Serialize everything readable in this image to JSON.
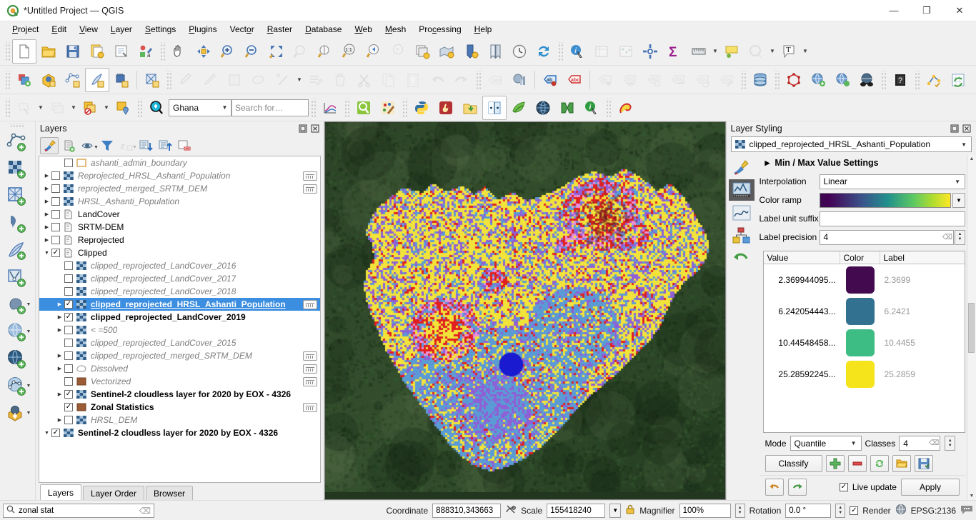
{
  "window": {
    "title": "*Untitled Project — QGIS",
    "app_icon": "qgis-logo-icon",
    "minimize": "—",
    "maximize": "❐",
    "close": "✕"
  },
  "menubar": {
    "items": [
      {
        "label": "Project",
        "accel": "P"
      },
      {
        "label": "Edit",
        "accel": "E"
      },
      {
        "label": "View",
        "accel": "V"
      },
      {
        "label": "Layer",
        "accel": "L"
      },
      {
        "label": "Settings",
        "accel": "S"
      },
      {
        "label": "Plugins",
        "accel": "P"
      },
      {
        "label": "Vector",
        "accel": "o"
      },
      {
        "label": "Raster",
        "accel": "R"
      },
      {
        "label": "Database",
        "accel": "D"
      },
      {
        "label": "Web",
        "accel": "W"
      },
      {
        "label": "Mesh",
        "accel": "M"
      },
      {
        "label": "Processing",
        "accel": "c"
      },
      {
        "label": "Help",
        "accel": "H"
      }
    ]
  },
  "toolbar": {
    "row1": [
      "new-project-icon",
      "open-project-icon",
      "save-project-icon",
      "save-project-as-icon",
      "new-print-layout-icon",
      "style-manager-icon",
      "sep",
      "pan-map-icon",
      "pan-to-selection-icon",
      "zoom-in-icon",
      "zoom-out-icon",
      "zoom-full-icon",
      "zoom-to-selection-icon",
      "zoom-to-layer-icon",
      "zoom-native-icon",
      "zoom-last-icon",
      "zoom-next-icon",
      "refresh-layer-icon",
      "new-map-view-icon",
      "new-3d-map-view-icon",
      "bookmarks-icon",
      "temporal-controller-icon",
      "refresh-icon",
      "sep",
      "identify-features-icon",
      "open-attribute-table-icon",
      "statistical-summary-icon",
      "options-icon",
      "sum-icon",
      "measure-line-icon",
      "map-tips-icon",
      "show-pinned-labels-icon",
      "text-annotation-icon"
    ],
    "row2": [
      "new-shapefile-layer-icon",
      "new-geopackage-layer-icon",
      "new-spatialite-layer-icon",
      "new-virtual-layer-icon",
      "new-memory-layer-icon",
      "sep",
      "new-mesh-layer-icon",
      "sep",
      "current-edits-icon",
      "toggle-editing-icon",
      "save-layer-edits-icon",
      "add-polygon-feature-icon",
      "vertex-tool-icon",
      "modify-attributes-icon",
      "delete-selected-icon",
      "cut-features-icon",
      "copy-features-icon",
      "paste-features-icon",
      "undo-icon",
      "redo-icon",
      "sep",
      "label-icon",
      "diagram-icon",
      "sep",
      "pin-labels-icon",
      "highlight-labels-icon",
      "sep",
      "move-label-icon",
      "show-hide-labels-icon",
      "change-label-icon",
      "rotate-label-icon",
      "move-label-part-icon",
      "revert-label-icon",
      "edit-label-icon",
      "sep",
      "database-manager-icon",
      "sep",
      "topology-checker-icon",
      "metasearch-icon",
      "metasearch-zoom-icon",
      "geocoding-icon",
      "sep",
      "help-contents-icon",
      "sep",
      "qgis-cloud-icon",
      "refresh-table-icon"
    ],
    "row3": [
      "select-features-icon",
      "select-dropdown",
      "deselect-icon",
      "deselect-dropdown",
      "select-value-icon",
      "select-value-dropdown",
      "select-by-location-icon",
      "sep",
      "locator-search-icon"
    ],
    "row3_combo_value": "Ghana",
    "row3_search_placeholder": "Search for…",
    "row3_right": [
      "profile-tool-icon",
      "sep",
      "search-layers-icon",
      "plugin-paint-icon",
      "sep",
      "python-console-icon",
      "qgis-resource-sharing-icon",
      "data-plotly-icon",
      "swipe-tool-icon",
      "leaflet-icon",
      "globe-icon",
      "freehand-icon",
      "info-plugin-icon",
      "sep",
      "lasso-icon"
    ]
  },
  "left_toolbar": {
    "items": [
      "add-vector-layer-icon",
      "add-raster-layer-icon",
      "add-mesh-layer-icon",
      "add-delimited-text-layer-icon",
      "add-spatialite-layer-icon",
      "add-virtual-layer-icon",
      "add-postgis-layer-icon",
      "add-mssql-layer-icon",
      "add-wms-layer-icon",
      "add-wfs-layer-icon",
      "add-wcs-layer-icon"
    ]
  },
  "layers_panel": {
    "title": "Layers",
    "dock_buttons": [
      "undock-icon",
      "close-icon"
    ],
    "toolbar": [
      "open-layer-styling-icon",
      "add-group-icon",
      "manage-visibility-icon",
      "filter-legend-icon",
      "filter-legend-expression-icon",
      "expand-all-icon",
      "collapse-all-icon",
      "remove-layer-icon"
    ],
    "tabs": [
      {
        "label": "Layers",
        "active": true
      },
      {
        "label": "Layer Order",
        "active": false
      },
      {
        "label": "Browser",
        "active": false
      }
    ],
    "items": [
      {
        "name": "ashanti_admin_boundary",
        "indent": 1,
        "expander": false,
        "checked": false,
        "icon": "polygon-outline-icon",
        "style": "italic-grey",
        "chip": false
      },
      {
        "name": "Reprojected_HRSL_Ashanti_Population",
        "indent": 0,
        "expander": true,
        "checked": false,
        "icon": "raster-icon",
        "style": "italic-grey",
        "chip": true
      },
      {
        "name": "reprojected_merged_SRTM_DEM",
        "indent": 0,
        "expander": true,
        "checked": false,
        "icon": "raster-icon",
        "style": "italic-grey",
        "chip": true
      },
      {
        "name": "HRSL_Ashanti_Population",
        "indent": 0,
        "expander": true,
        "checked": false,
        "icon": "raster-icon",
        "style": "italic-grey",
        "chip": false
      },
      {
        "name": "LandCover",
        "indent": 0,
        "expander": true,
        "checked": false,
        "icon": "group-icon",
        "style": "normal",
        "chip": false
      },
      {
        "name": "SRTM-DEM",
        "indent": 0,
        "expander": true,
        "checked": false,
        "icon": "group-icon",
        "style": "normal",
        "chip": false
      },
      {
        "name": "Reprojected",
        "indent": 0,
        "expander": true,
        "checked": false,
        "icon": "group-icon",
        "style": "normal",
        "chip": false
      },
      {
        "name": "Clipped",
        "indent": 0,
        "expander": "open",
        "checked": true,
        "icon": "group-icon",
        "style": "normal",
        "chip": false
      },
      {
        "name": "clipped_reprojected_LandCover_2016",
        "indent": 1,
        "expander": false,
        "checked": false,
        "icon": "raster-icon",
        "style": "italic-grey",
        "chip": false
      },
      {
        "name": "clipped_reprojected_LandCover_2017",
        "indent": 1,
        "expander": false,
        "checked": false,
        "icon": "raster-icon",
        "style": "italic-grey",
        "chip": false
      },
      {
        "name": "clipped_reprojected_LandCover_2018",
        "indent": 1,
        "expander": false,
        "checked": false,
        "icon": "raster-icon",
        "style": "italic-grey",
        "chip": false
      },
      {
        "name": "clipped_reprojected_HRSL_Ashanti_Population",
        "indent": 1,
        "expander": true,
        "checked": true,
        "icon": "raster-icon",
        "style": "selected",
        "chip": true,
        "selected": true
      },
      {
        "name": "clipped_reprojected_LandCover_2019",
        "indent": 1,
        "expander": true,
        "checked": true,
        "icon": "raster-icon",
        "style": "bold",
        "chip": false
      },
      {
        "name": "< =500",
        "indent": 1,
        "expander": true,
        "checked": false,
        "icon": "raster-icon",
        "style": "italic-grey",
        "chip": false
      },
      {
        "name": "clipped_reprojected_LandCover_2015",
        "indent": 1,
        "expander": false,
        "checked": false,
        "icon": "raster-icon",
        "style": "italic-grey",
        "chip": false
      },
      {
        "name": "clipped_reprojected_merged_SRTM_DEM",
        "indent": 1,
        "expander": true,
        "checked": false,
        "icon": "raster-icon",
        "style": "italic-grey",
        "chip": true
      },
      {
        "name": "Dissolved",
        "indent": 1,
        "expander": true,
        "checked": false,
        "icon": "polygon-grey-icon",
        "style": "italic-grey",
        "chip": true
      },
      {
        "name": "Vectorized",
        "indent": 1,
        "expander": false,
        "checked": false,
        "icon": "polygon-brown-icon",
        "style": "italic-grey",
        "chip": true
      },
      {
        "name": "Sentinel-2 cloudless layer for 2020 by EOX - 4326",
        "indent": 1,
        "expander": true,
        "checked": true,
        "icon": "raster-icon",
        "style": "bold",
        "chip": false
      },
      {
        "name": "Zonal Statistics",
        "indent": 1,
        "expander": false,
        "checked": true,
        "icon": "polygon-brown-icon",
        "style": "bold",
        "chip": true
      },
      {
        "name": "HRSL_DEM",
        "indent": 1,
        "expander": true,
        "checked": false,
        "icon": "raster-icon",
        "style": "italic-grey",
        "chip": false
      },
      {
        "name": "Sentinel-2 cloudless layer for 2020 by EOX - 4326",
        "indent": 0,
        "expander": "open",
        "checked": true,
        "icon": "raster-icon",
        "style": "bold",
        "chip": false
      }
    ]
  },
  "style_panel": {
    "title": "Layer Styling",
    "dock_buttons": [
      "undock-icon",
      "close-icon"
    ],
    "layer_combo": "clipped_reprojected_HRSL_Ashanti_Population",
    "side_icons": [
      "symbology-brush-icon",
      "histogram-icon",
      "transparency-icon",
      "3d-view-icon",
      "undo-history-icon"
    ],
    "section_title": "Min / Max Value Settings",
    "fields": {
      "interpolation_label": "Interpolation",
      "interpolation_value": "Linear",
      "color_ramp_label": "Color ramp",
      "label_unit_suffix_label": "Label unit suffix",
      "label_unit_suffix_value": "",
      "label_precision_label": "Label precision",
      "label_precision_value": "4"
    },
    "table": {
      "headers": [
        "Value",
        "Color",
        "Label"
      ],
      "rows": [
        {
          "value": "2.369944095...",
          "color": "#440a4f",
          "label": "2.3699"
        },
        {
          "value": "6.242054443...",
          "color": "#32718f",
          "label": "6.2421"
        },
        {
          "value": "10.44548458...",
          "color": "#3dbd84",
          "label": "10.4455"
        },
        {
          "value": "25.28592245...",
          "color": "#f5e31b",
          "label": "25.2859"
        }
      ]
    },
    "mode_label": "Mode",
    "mode_value": "Quantile",
    "classes_label": "Classes",
    "classes_value": "4",
    "classify_button": "Classify",
    "action_buttons": [
      "add-class-icon",
      "remove-class-icon",
      "reload-icon",
      "load-style-icon",
      "save-style-icon"
    ],
    "undo_buttons": [
      "undo-icon",
      "redo-icon"
    ],
    "live_update_label": "Live update",
    "live_update_checked": true,
    "apply_button": "Apply"
  },
  "statusbar": {
    "locator_placeholder": "Search",
    "locator_value": "zonal stat",
    "locator_icon": "search-icon",
    "locator_clear_icon": "clear-icon",
    "coordinate_label": "Coordinate",
    "coordinate_value": "888310,343663",
    "coordinate_toggle_icon": "toggle-extents-icon",
    "scale_label": "Scale",
    "scale_value": "155418240",
    "lock_icon": "lock-icon",
    "magnifier_label": "Magnifier",
    "magnifier_value": "100%",
    "rotation_label": "Rotation",
    "rotation_value": "0.0 °",
    "render_label": "Render",
    "render_checked": true,
    "crs_icon": "globe-icon",
    "crs_label": "EPSG:2136",
    "messages_icon": "messages-icon"
  },
  "map": {
    "basemap_colors": [
      "#2c4427",
      "#3a5431",
      "#46603a",
      "#22351f",
      "#5a6b4a"
    ],
    "class_colors": [
      "#f2e33a",
      "#5b9bd5",
      "#8f5fd6",
      "#e02020",
      "#e890d8",
      "#1a1ad0",
      "#7a2020"
    ],
    "description": "raster population classification over Sentinel-2 basemap of Ashanti region"
  }
}
